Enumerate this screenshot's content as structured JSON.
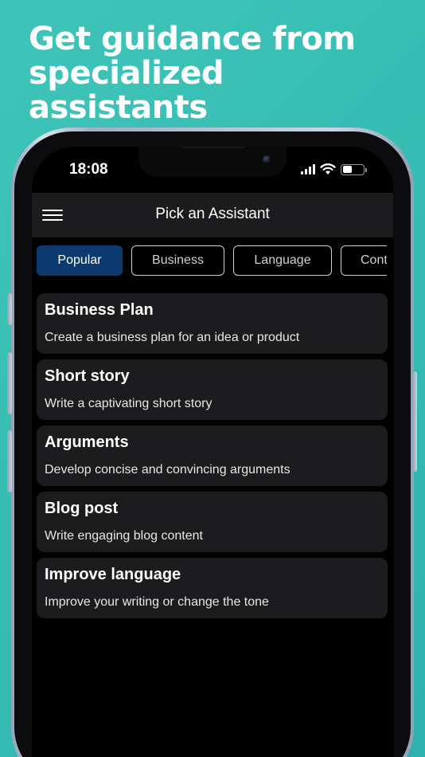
{
  "headline": {
    "line1": "Get guidance from",
    "line2": "specialized assistants"
  },
  "status_bar": {
    "time": "18:08",
    "icons": [
      "cellular-signal-icon",
      "wifi-icon",
      "battery-icon"
    ]
  },
  "navbar": {
    "menu_icon": "hamburger-menu-icon",
    "title": "Pick an Assistant"
  },
  "tabs": [
    {
      "label": "Popular",
      "active": true
    },
    {
      "label": "Business",
      "active": false
    },
    {
      "label": "Language",
      "active": false
    },
    {
      "label": "Cont",
      "active": false
    }
  ],
  "assistants": [
    {
      "title": "Business Plan",
      "description": "Create a business plan for an idea or product"
    },
    {
      "title": "Short story",
      "description": "Write a captivating short story"
    },
    {
      "title": "Arguments",
      "description": "Develop concise and convincing arguments"
    },
    {
      "title": "Blog post",
      "description": "Write engaging blog content"
    },
    {
      "title": "Improve language",
      "description": "Improve your writing or change the tone"
    }
  ],
  "colors": {
    "background_teal": "#35bdb3",
    "active_tab": "#0a3a6e",
    "card_bg": "#1c1c1e",
    "screen_bg": "#000000"
  }
}
